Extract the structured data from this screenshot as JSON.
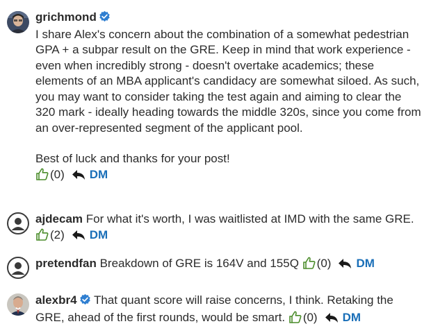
{
  "comments": [
    {
      "username": "grichmond",
      "verified": true,
      "avatar": "photo-avatar",
      "text_paragraphs": [
        "I share Alex's concern about the combination of a somewhat pedestrian GPA + a subpar result on the GRE.  Keep in mind that work experience - even when incredibly strong - doesn't overtake academics; these elements of an MBA applicant's candidacy are somewhat siloed.  As such, you may want to consider taking the test again and aiming to clear the 320 mark - ideally heading towards the middle 320s, since you come from an over-represented segment of the applicant pool.",
        "Best of luck and thanks for your post!"
      ],
      "likes": "(0)",
      "dm_label": "DM"
    },
    {
      "username": "ajdecam",
      "verified": false,
      "avatar": "generic-user-icon",
      "text": "For what it's worth, I was waitlisted at IMD with the same GRE.",
      "likes": "(2)",
      "dm_label": "DM"
    },
    {
      "username": "pretendfan",
      "verified": false,
      "avatar": "generic-user-icon",
      "text": "Breakdown of GRE is 164V and 155Q",
      "likes": "(0)",
      "dm_label": "DM"
    },
    {
      "username": "alexbr4",
      "verified": true,
      "avatar": "photo-avatar",
      "text": "That quant score will raise concerns, I think. Retaking the GRE, ahead of the first rounds, would be smart.",
      "likes": "(0)",
      "dm_label": "DM"
    }
  ],
  "colors": {
    "verified": "#2f7fd1",
    "dm_link": "#1a6fb8",
    "like_icon": "#4a8c2a",
    "text": "#2b2b2b"
  }
}
